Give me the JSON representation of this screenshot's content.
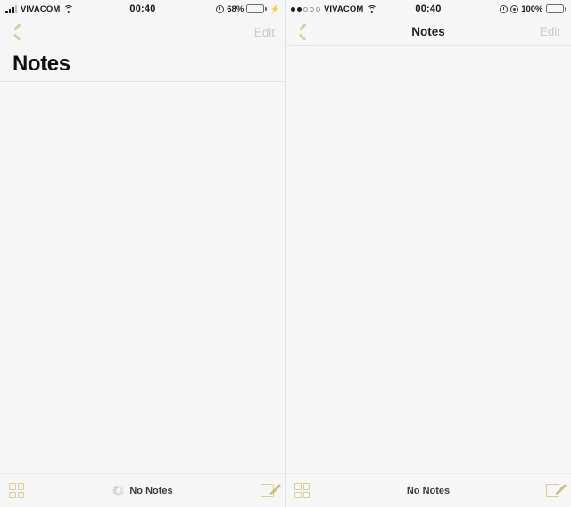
{
  "left_screen": {
    "status_bar": {
      "signal_type": "bars",
      "signal_bars_filled": 3,
      "signal_bars_total": 4,
      "carrier": "VIVACOM",
      "wifi_icon": "wifi-icon",
      "time": "00:40",
      "alarm_icon": "alarm-clock-icon",
      "battery_percent": "68%",
      "battery_level": 68,
      "battery_color": "#4cd964",
      "charging_icon": "lightning-bolt-icon"
    },
    "nav_bar": {
      "back_icon": "back-chevron-icon",
      "back_color": "#d9cf9a",
      "title": "",
      "edit_label": "Edit",
      "edit_disabled": true
    },
    "large_title": "Notes",
    "toolbar": {
      "grid_icon": "grid-view-icon",
      "spinner_icon": "loading-spinner-icon",
      "status_label": "No Notes",
      "compose_icon": "compose-note-icon",
      "accent_color": "#d8cd93"
    }
  },
  "right_screen": {
    "status_bar": {
      "signal_type": "dots",
      "signal_dots_filled": 2,
      "signal_dots_total": 5,
      "carrier": "VIVACOM",
      "wifi_icon": "wifi-icon",
      "time": "00:40",
      "alarm_icon": "alarm-clock-icon",
      "location_icon": "location-target-icon",
      "battery_percent": "100%",
      "battery_level": 100,
      "battery_color": "#1b1b1b"
    },
    "nav_bar": {
      "back_icon": "back-chevron-icon",
      "back_color": "#d9cf9a",
      "title": "Notes",
      "edit_label": "Edit",
      "edit_disabled": true
    },
    "toolbar": {
      "grid_icon": "grid-view-icon",
      "status_label": "No Notes",
      "compose_icon": "compose-note-icon",
      "accent_color": "#d8cd93"
    }
  }
}
